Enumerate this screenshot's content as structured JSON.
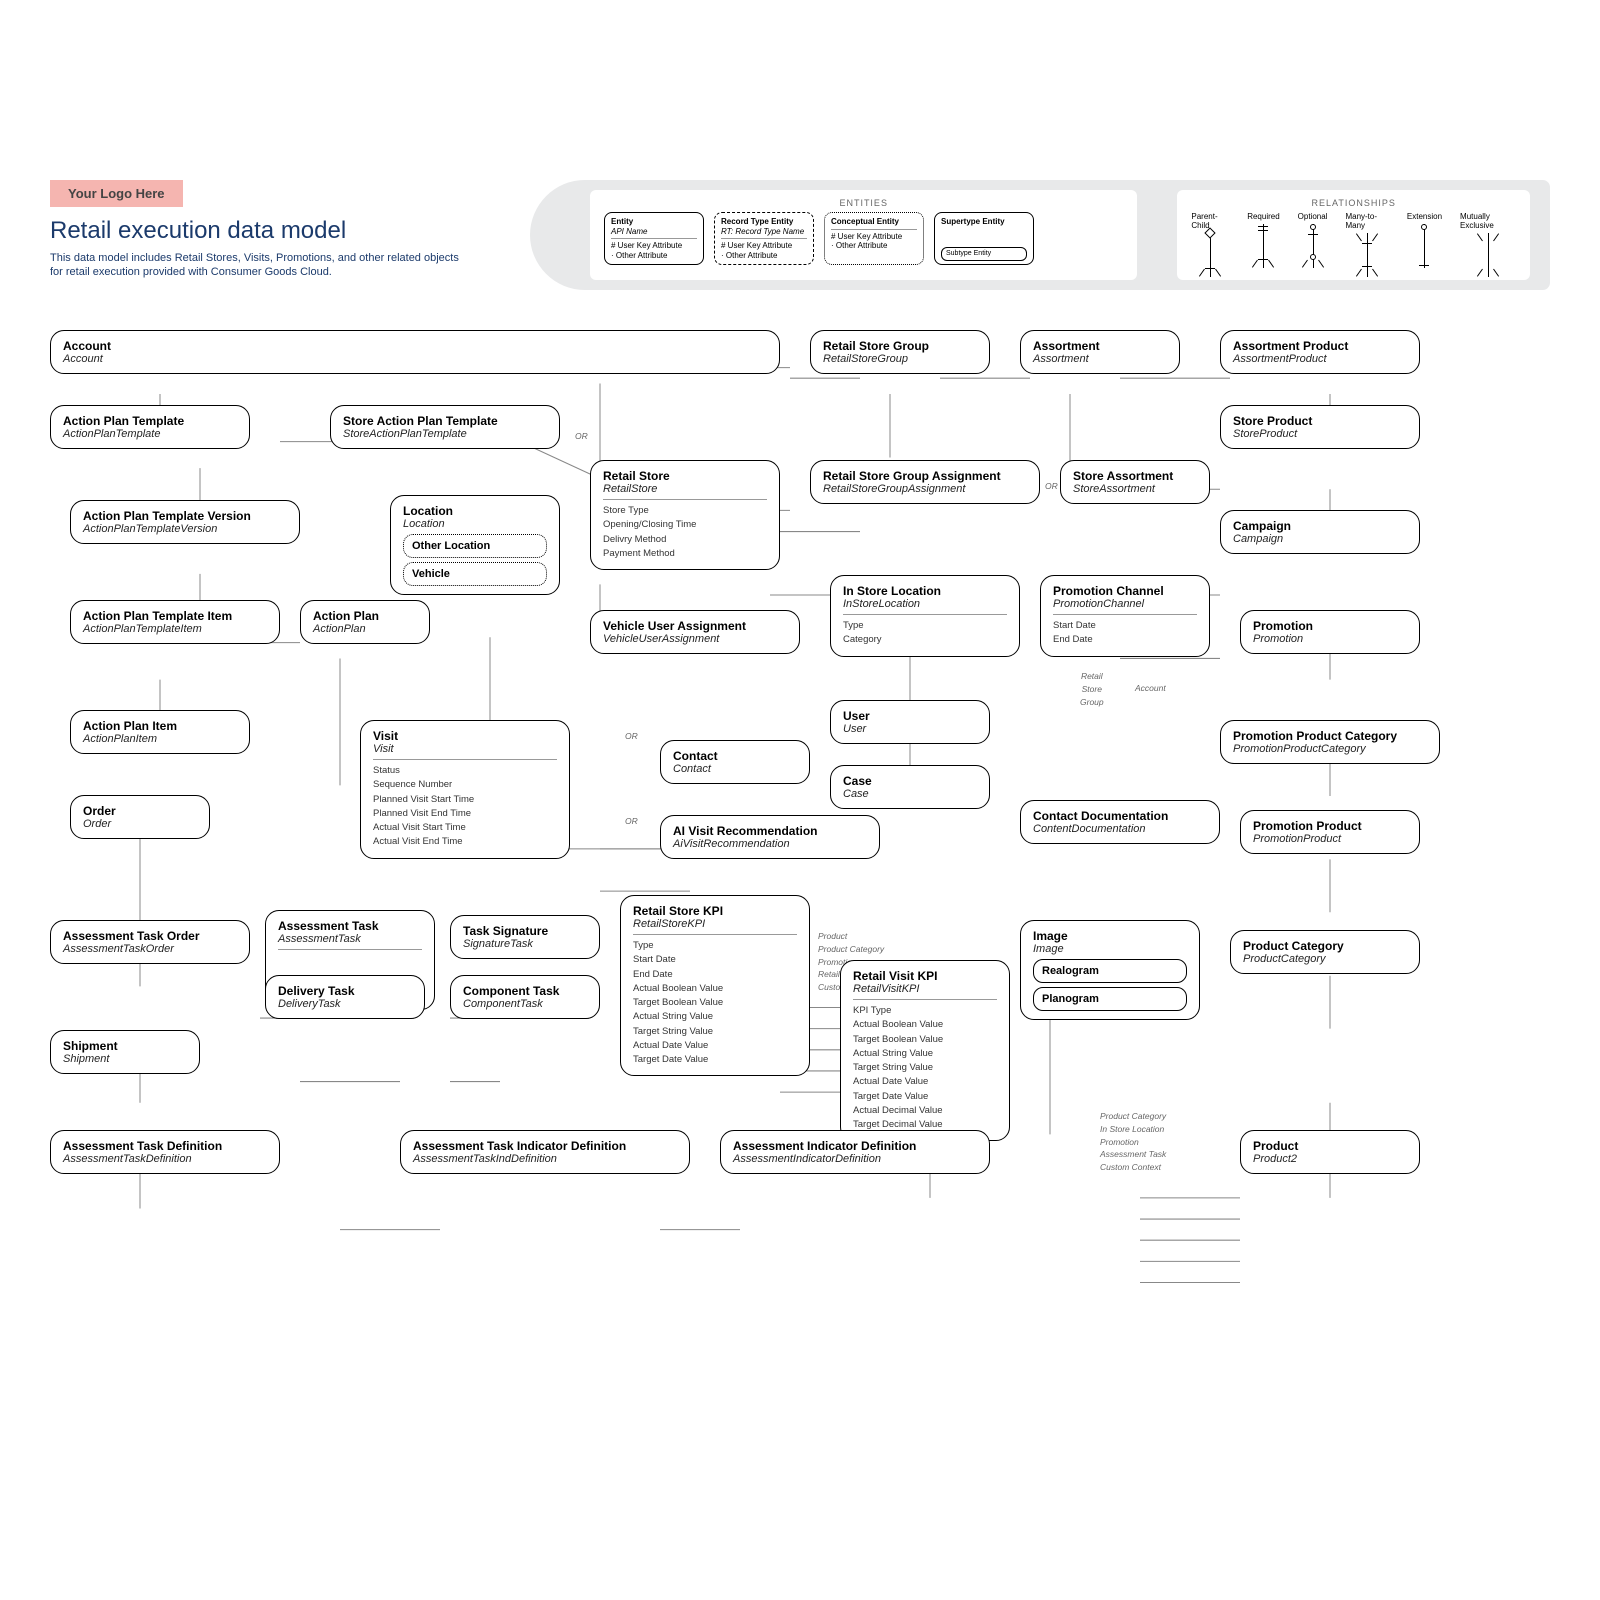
{
  "header": {
    "logo": "Your Logo Here",
    "title": "Retail execution data model",
    "subtitle": "This data model includes Retail Stores, Visits, Promotions, and other related objects for retail execution provided with Consumer Goods Cloud."
  },
  "legend": {
    "entities_label": "ENTITIES",
    "relationships_label": "RELATIONSHIPS",
    "entity_box": {
      "title": "Entity",
      "api": "API Name",
      "attr1": "# User Key Attribute",
      "attr2": "· Other Attribute"
    },
    "record_box": {
      "title": "Record Type Entity",
      "api": "RT: Record Type Name",
      "attr1": "# User Key Attribute",
      "attr2": "· Other Attribute"
    },
    "conceptual_box": {
      "title": "Conceptual Entity",
      "attr1": "# User Key Attribute",
      "attr2": "· Other Attribute"
    },
    "supertype_box": {
      "title": "Supertype Entity",
      "sub": "Subtype Entity"
    },
    "rels": [
      "Parent-Child",
      "Required",
      "Optional",
      "Many-to-Many",
      "Extension",
      "Mutually Exclusive"
    ]
  },
  "entities": {
    "account": {
      "name": "Account",
      "api": "Account"
    },
    "actionPlanTemplate": {
      "name": "Action Plan Template",
      "api": "ActionPlanTemplate"
    },
    "storeActionPlanTemplate": {
      "name": "Store Action Plan Template",
      "api": "StoreActionPlanTemplate"
    },
    "actionPlanTemplateVersion": {
      "name": "Action Plan Template Version",
      "api": "ActionPlanTemplateVersion"
    },
    "actionPlanTemplateItem": {
      "name": "Action Plan Template Item",
      "api": "ActionPlanTemplateItem"
    },
    "actionPlan": {
      "name": "Action Plan",
      "api": "ActionPlan"
    },
    "actionPlanItem": {
      "name": "Action Plan Item",
      "api": "ActionPlanItem"
    },
    "order": {
      "name": "Order",
      "api": "Order"
    },
    "assessmentTaskOrder": {
      "name": "Assessment Task Order",
      "api": "AssessmentTaskOrder"
    },
    "shipment": {
      "name": "Shipment",
      "api": "Shipment"
    },
    "assessmentTaskDefinition": {
      "name": "Assessment Task Definition",
      "api": "AssessmentTaskDefinition"
    },
    "location": {
      "name": "Location",
      "api": "Location",
      "sub1": "Other Location",
      "sub2": "Vehicle"
    },
    "visit": {
      "name": "Visit",
      "api": "Visit",
      "attrs": [
        "Status",
        "Sequence Number",
        "Planned Visit Start Time",
        "Planned Visit End Time",
        "Actual Visit Start Time",
        "Actual Visit End Time"
      ]
    },
    "assessmentTask": {
      "name": "Assessment Task",
      "api": "AssessmentTask"
    },
    "deliveryTask": {
      "name": "Delivery Task",
      "api": "DeliveryTask"
    },
    "taskSignature": {
      "name": "Task Signature",
      "api": "SignatureTask"
    },
    "componentTask": {
      "name": "Component Task",
      "api": "ComponentTask"
    },
    "assessmentTaskIndDef": {
      "name": "Assessment Task Indicator Definition",
      "api": "AssessmentTaskIndDefinition"
    },
    "retailStore": {
      "name": "Retail Store",
      "api": "RetailStore",
      "attrs": [
        "Store Type",
        "Opening/Closing Time",
        "Delivry Method",
        "Payment Method"
      ]
    },
    "vehicleUserAssignment": {
      "name": "Vehicle User Assignment",
      "api": "VehicleUserAssignment"
    },
    "contact": {
      "name": "Contact",
      "api": "Contact"
    },
    "aiVisitRecommendation": {
      "name": "AI Visit Recommendation",
      "api": "AiVisitRecommendation"
    },
    "retailStoreKPI": {
      "name": "Retail Store KPI",
      "api": "RetailStoreKPI",
      "attrs": [
        "Type",
        "Start Date",
        "End Date",
        "Actual Boolean Value",
        "Target Boolean Value",
        "Actual String Value",
        "Target String Value",
        "Actual Date Value",
        "Target Date Value"
      ]
    },
    "assessmentIndicatorDefinition": {
      "name": "Assessment Indicator Definition",
      "api": "AssessmentIndicatorDefinition"
    },
    "retailStoreGroup": {
      "name": "Retail Store Group",
      "api": "RetailStoreGroup"
    },
    "retailStoreGroupAssignment": {
      "name": "Retail Store Group Assignment",
      "api": "RetailStoreGroupAssignment"
    },
    "inStoreLocation": {
      "name": "In Store Location",
      "api": "InStoreLocation",
      "attrs": [
        "Type",
        "Category"
      ]
    },
    "user": {
      "name": "User",
      "api": "User"
    },
    "case": {
      "name": "Case",
      "api": "Case"
    },
    "retailVisitKPI": {
      "name": "Retail Visit KPI",
      "api": "RetailVisitKPI",
      "attrs": [
        "KPI Type",
        "Actual Boolean Value",
        "Target Boolean Value",
        "Actual String Value",
        "Target String Value",
        "Actual Date Value",
        "Target Date Value",
        "Actual Decimal Value",
        "Target Decimal Value"
      ]
    },
    "assortment": {
      "name": "Assortment",
      "api": "Assortment"
    },
    "storeAssortment": {
      "name": "Store Assortment",
      "api": "StoreAssortment"
    },
    "promotionChannel": {
      "name": "Promotion Channel",
      "api": "PromotionChannel",
      "attrs": [
        "Start Date",
        "End Date"
      ]
    },
    "contactDocumentation": {
      "name": "Contact Documentation",
      "api": "ContentDocumentation"
    },
    "image": {
      "name": "Image",
      "api": "Image",
      "sub1": "Realogram",
      "sub2": "Planogram"
    },
    "assortmentProduct": {
      "name": "Assortment Product",
      "api": "AssortmentProduct"
    },
    "storeProduct": {
      "name": "Store Product",
      "api": "StoreProduct"
    },
    "campaign": {
      "name": "Campaign",
      "api": "Campaign"
    },
    "promotion": {
      "name": "Promotion",
      "api": "Promotion"
    },
    "promotionProductCategory": {
      "name": "Promotion Product Category",
      "api": "PromotionProductCategory"
    },
    "promotionProduct": {
      "name": "Promotion Product",
      "api": "PromotionProduct"
    },
    "productCategory": {
      "name": "Product Category",
      "api": "ProductCategory"
    },
    "product": {
      "name": "Product",
      "api": "Product2"
    }
  },
  "linkLabels": {
    "or1": "OR",
    "or2": "OR",
    "or3": "OR",
    "or4": "OR",
    "retailStoreGroupAccount": {
      "l1": "Retail",
      "l2": "Store",
      "l3": "Group",
      "l4": "Account"
    },
    "kpiLinks": [
      "Product",
      "Product Category",
      "Promotion",
      "Retail Store Group",
      "Custom Context"
    ],
    "productLinks": [
      "Product Category",
      "In Store Location",
      "Promotion",
      "Assessment Task",
      "Custom Context"
    ]
  }
}
